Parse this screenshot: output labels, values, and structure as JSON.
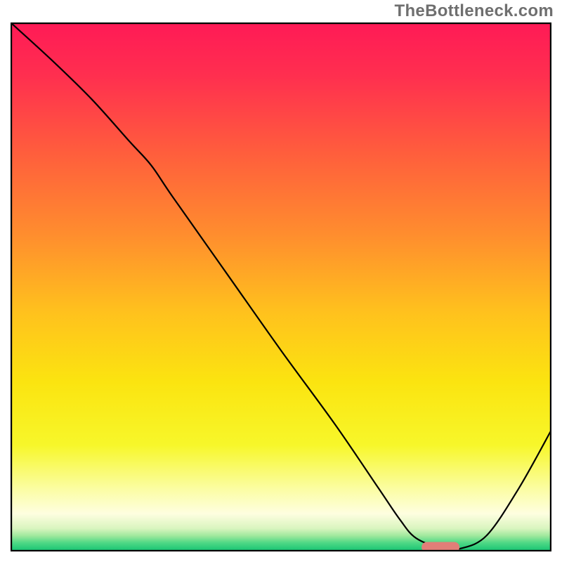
{
  "attribution": "TheBottleneck.com",
  "chart_data": {
    "type": "line",
    "title": "",
    "xlabel": "",
    "ylabel": "",
    "xlim": [
      0,
      100
    ],
    "ylim": [
      0,
      100
    ],
    "legend": false,
    "grid": false,
    "frame": true,
    "background_gradient": {
      "stops": [
        {
          "pos": 0.0,
          "color": "#ff1a56"
        },
        {
          "pos": 0.1,
          "color": "#ff2f4f"
        },
        {
          "pos": 0.25,
          "color": "#ff5f3c"
        },
        {
          "pos": 0.4,
          "color": "#ff8d2e"
        },
        {
          "pos": 0.55,
          "color": "#ffc21d"
        },
        {
          "pos": 0.68,
          "color": "#fbe410"
        },
        {
          "pos": 0.8,
          "color": "#f7f72a"
        },
        {
          "pos": 0.88,
          "color": "#fbfd9f"
        },
        {
          "pos": 0.93,
          "color": "#fefee0"
        },
        {
          "pos": 0.958,
          "color": "#d9f5bf"
        },
        {
          "pos": 0.972,
          "color": "#9ee89c"
        },
        {
          "pos": 0.985,
          "color": "#4fd885"
        },
        {
          "pos": 1.0,
          "color": "#18c574"
        }
      ]
    },
    "series": [
      {
        "name": "bottleneck-curve",
        "stroke": "#000000",
        "stroke_width": 2.2,
        "x": [
          0.0,
          7.5,
          15.0,
          22.0,
          26.0,
          30.0,
          40.0,
          50.0,
          60.0,
          68.0,
          72.0,
          75.0,
          80.0,
          83.0,
          88.0,
          94.0,
          100.0
        ],
        "y": [
          100.0,
          93.0,
          85.5,
          77.5,
          73.0,
          67.0,
          52.5,
          38.0,
          24.0,
          12.0,
          6.0,
          2.5,
          0.5,
          0.5,
          3.0,
          12.0,
          23.0
        ]
      }
    ],
    "marker": {
      "name": "optimal-zone",
      "color": "#e17e78",
      "x_center": 79.5,
      "y": 0.8,
      "width_x": 7.0,
      "height_y": 2.0,
      "rx": 1.0
    }
  }
}
